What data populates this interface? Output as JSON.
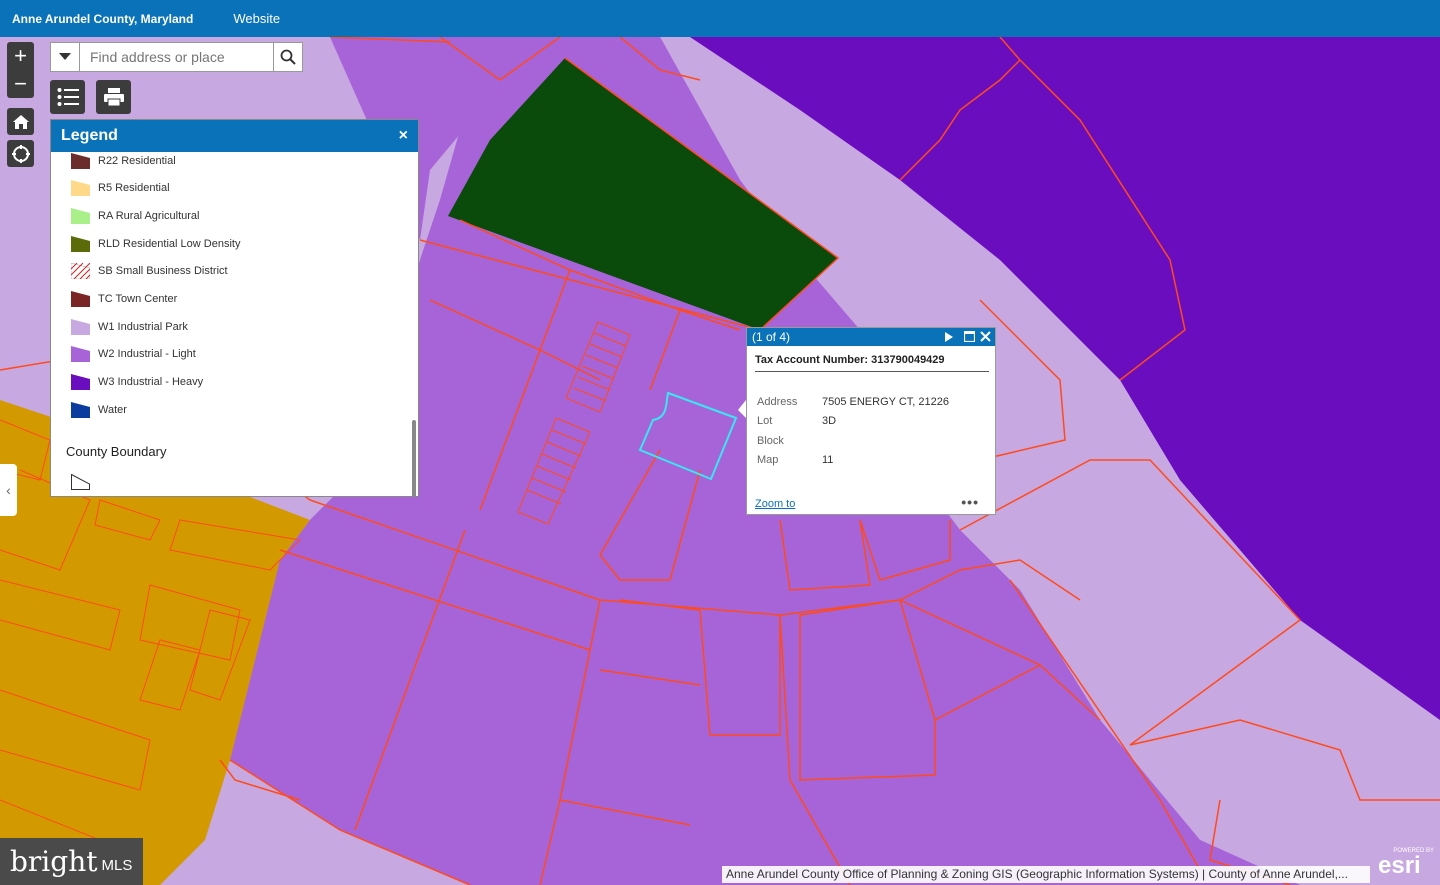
{
  "header": {
    "title": "Anne Arundel County, Maryland",
    "website_link": "Website"
  },
  "map_controls": {
    "zoom_in": "+",
    "zoom_out": "−",
    "icons": [
      "plus-icon",
      "minus-icon",
      "home-icon",
      "locate-icon",
      "list-icon",
      "print-icon",
      "search-icon",
      "chevron-down-icon"
    ]
  },
  "search": {
    "placeholder": "Find address or place"
  },
  "legend": {
    "title": "Legend",
    "close": "×",
    "items": [
      {
        "label": "R22 Residential",
        "color": "#6b2c2c"
      },
      {
        "label": "R5 Residential",
        "color": "#ffd98a"
      },
      {
        "label": "RA Rural Agricultural",
        "color": "#aaf08a"
      },
      {
        "label": "RLD Residential Low Density",
        "color": "#5c6b0a"
      },
      {
        "label": "SB Small Business District",
        "color": "#ffffff"
      },
      {
        "label": "TC Town Center",
        "color": "#7a2626"
      },
      {
        "label": "W1 Industrial Park",
        "color": "#c8a8e0"
      },
      {
        "label": "W2 Industrial - Light",
        "color": "#a764d8"
      },
      {
        "label": "W3 Industrial - Heavy",
        "color": "#6a0dbf"
      },
      {
        "label": "Water",
        "color": "#0a3d9e"
      }
    ],
    "section2_title": "County Boundary"
  },
  "popup": {
    "counter": "(1 of 4)",
    "title": "Tax Account Number: 313790049429",
    "fields": [
      {
        "key": "Address",
        "value": "7505 ENERGY CT, 21226"
      },
      {
        "key": "Lot",
        "value": "3D"
      },
      {
        "key": "Block",
        "value": ""
      },
      {
        "key": "Map",
        "value": "11"
      }
    ],
    "zoom_to": "Zoom to",
    "more": "•••"
  },
  "attribution": "Anne Arundel County Office of Planning & Zoning GIS (Geographic Information Systems) | County of Anne Arundel,...",
  "branding": {
    "bright": "bright",
    "mls": "MLS",
    "powered_by": "POWERED BY",
    "esri": "esri"
  },
  "colors": {
    "header": "#0a72b8",
    "w2": "#a764d8",
    "w3": "#6a0dbf",
    "w1": "#c8a8e0",
    "rld": "#0a4a0a",
    "orange": "#d39a00",
    "parcel_line": "#ff4a1c",
    "selection": "#38e8f0"
  }
}
